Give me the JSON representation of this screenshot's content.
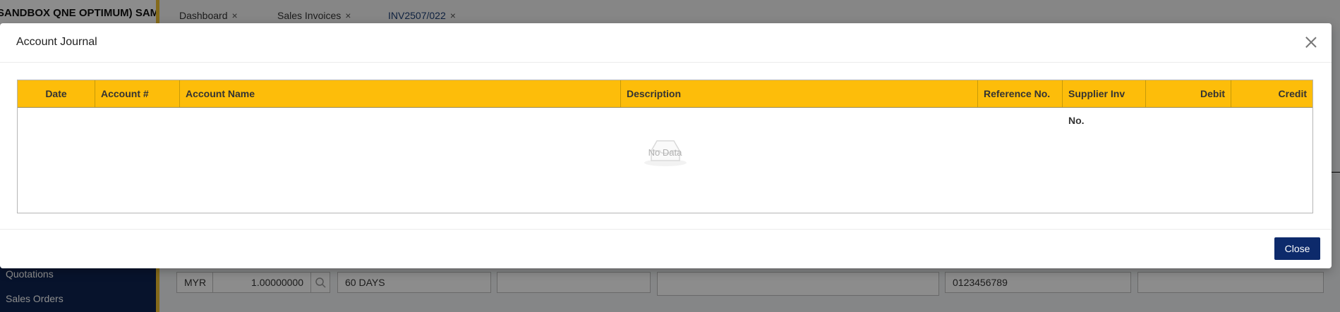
{
  "app": {
    "company_name": "SANDBOX QNE OPTIMUM) SAM...",
    "tabs": [
      {
        "label": "Dashboard",
        "close": "×"
      },
      {
        "label": "Sales Invoices",
        "close": "×"
      },
      {
        "label": "INV2507/022",
        "close": "×"
      }
    ],
    "sidebar": {
      "items": [
        {
          "label": "Quotations"
        },
        {
          "label": "Sales Orders"
        }
      ]
    },
    "form": {
      "currency": "MYR",
      "rate": "1.00000000",
      "terms": "60 DAYS",
      "phone": "0123456789"
    }
  },
  "modal": {
    "title": "Account Journal",
    "columns": [
      "Date",
      "Account #",
      "Account Name",
      "Description",
      "Reference No.",
      "Supplier Inv No.",
      "Debit",
      "Credit"
    ],
    "rows": [],
    "empty_text": "No Data",
    "close_label": "Close"
  },
  "colors": {
    "header_bg": "#fdbd0a",
    "primary_button": "#0d2a6b",
    "sidebar_bg": "#0d2450"
  },
  "icons": {
    "close": "close-icon",
    "empty": "inbox-empty-icon",
    "search": "search-icon"
  }
}
